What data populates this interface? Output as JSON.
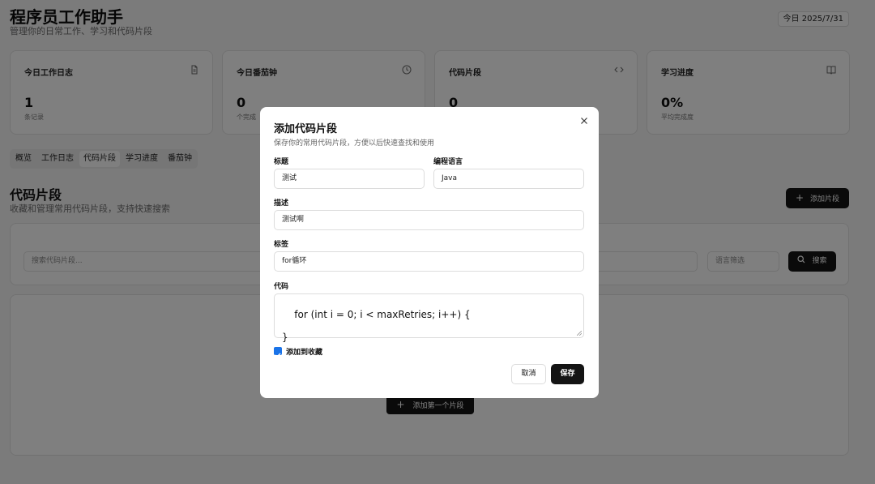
{
  "header": {
    "title": "程序员工作助手",
    "subtitle": "管理你的日常工作、学习和代码片段",
    "date_badge": "今日 2025/7/31"
  },
  "stats": [
    {
      "label": "今日工作日志",
      "icon": "file-icon",
      "value": "1",
      "sub": "条记录"
    },
    {
      "label": "今日番茄钟",
      "icon": "clock-icon",
      "value": "0",
      "sub": "个完成"
    },
    {
      "label": "代码片段",
      "icon": "code-icon",
      "value": "0",
      "sub": ""
    },
    {
      "label": "学习进度",
      "icon": "book-icon",
      "value": "0%",
      "sub": "平均完成度"
    }
  ],
  "tabs": [
    {
      "label": "概览",
      "active": false
    },
    {
      "label": "工作日志",
      "active": false
    },
    {
      "label": "代码片段",
      "active": true
    },
    {
      "label": "学习进度",
      "active": false
    },
    {
      "label": "番茄钟",
      "active": false
    }
  ],
  "section": {
    "title": "代码片段",
    "subtitle": "收藏和管理常用代码片段，支持快速搜索",
    "add_label": "添加片段"
  },
  "filters": {
    "search_placeholder": "搜索代码片段...",
    "language_placeholder": "语言筛选",
    "search_label": "搜索"
  },
  "empty": {
    "add_first_label": "添加第一个片段"
  },
  "modal": {
    "title": "添加代码片段",
    "description": "保存你的常用代码片段，方便以后快速查找和使用",
    "title_label": "标题",
    "title_value": "测试",
    "language_label": "编程语言",
    "language_value": "Java",
    "desc_label": "描述",
    "desc_value": "测试啊",
    "tags_label": "标签",
    "tags_value": "for循环",
    "code_label": "代码",
    "code_value": "for (int i = 0; i < maxRetries; i++) {\n\n}",
    "favorite_label": "添加到收藏",
    "favorite_checked": true,
    "cancel_label": "取消",
    "save_label": "保存"
  },
  "colors": {
    "primary": "#141414",
    "checkbox": "#1a73e8",
    "background": "#f6f6f7"
  }
}
